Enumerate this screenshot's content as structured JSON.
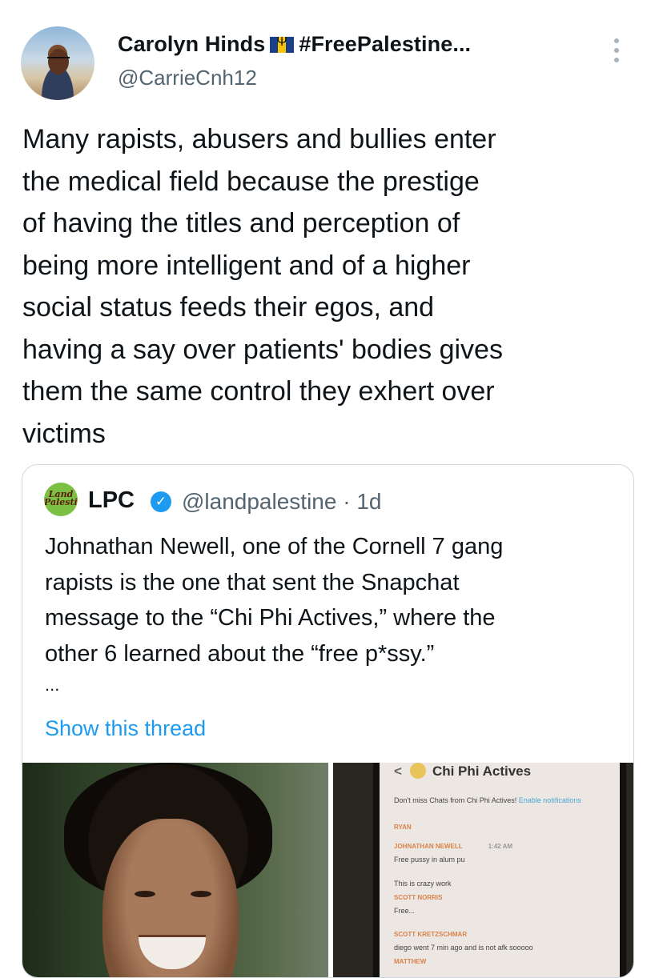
{
  "tweet": {
    "author_name": "Carolyn Hinds",
    "author_suffix": "#FreePalestine...",
    "author_handle": "@CarrieCnh12",
    "text_lines": [
      "Many rapists, abusers and bullies enter",
      "the medical field because the prestige",
      "of having the titles and perception of",
      "being more intelligent and of a higher",
      "social status feeds their egos, and",
      "having a say over patients' bodies gives",
      "them the same control they exhert over",
      "victims"
    ]
  },
  "quote": {
    "logo_text": "Land Palestine",
    "name": "LPC",
    "handle": "@landpalestine",
    "time": "· 1d",
    "text_lines": [
      "Johnathan Newell, one of the  Cornell 7 gang",
      "rapists is the one that sent the Snapchat",
      "message to the “Chi Phi Actives,” where the",
      "other 6 learned about the “free p*ssy.”"
    ],
    "ellipsis": "...",
    "show_thread": "Show this thread"
  },
  "chat": {
    "title": "Chi Phi Actives",
    "notice": "Don't miss Chats from Chi Phi Actives!",
    "notice_link": "Enable notifications",
    "messages": [
      {
        "sender": "RYAN",
        "text": ""
      },
      {
        "sender": "JOHNATHAN NEWELL",
        "time": "1:42 AM",
        "text": "Free pussy in alum pu"
      },
      {
        "sender": "",
        "text": "This is crazy work"
      },
      {
        "sender": "SCOTT NORRIS",
        "text": "Free..."
      },
      {
        "sender": "SCOTT KRETZSCHMAR",
        "text": "diego went 7 min ago and is not afk sooooo"
      },
      {
        "sender": "MATTHEW",
        "text": ""
      }
    ]
  },
  "colors": {
    "link": "#1d9bf0",
    "secondary_text": "#536471",
    "border": "#cfd9de"
  }
}
